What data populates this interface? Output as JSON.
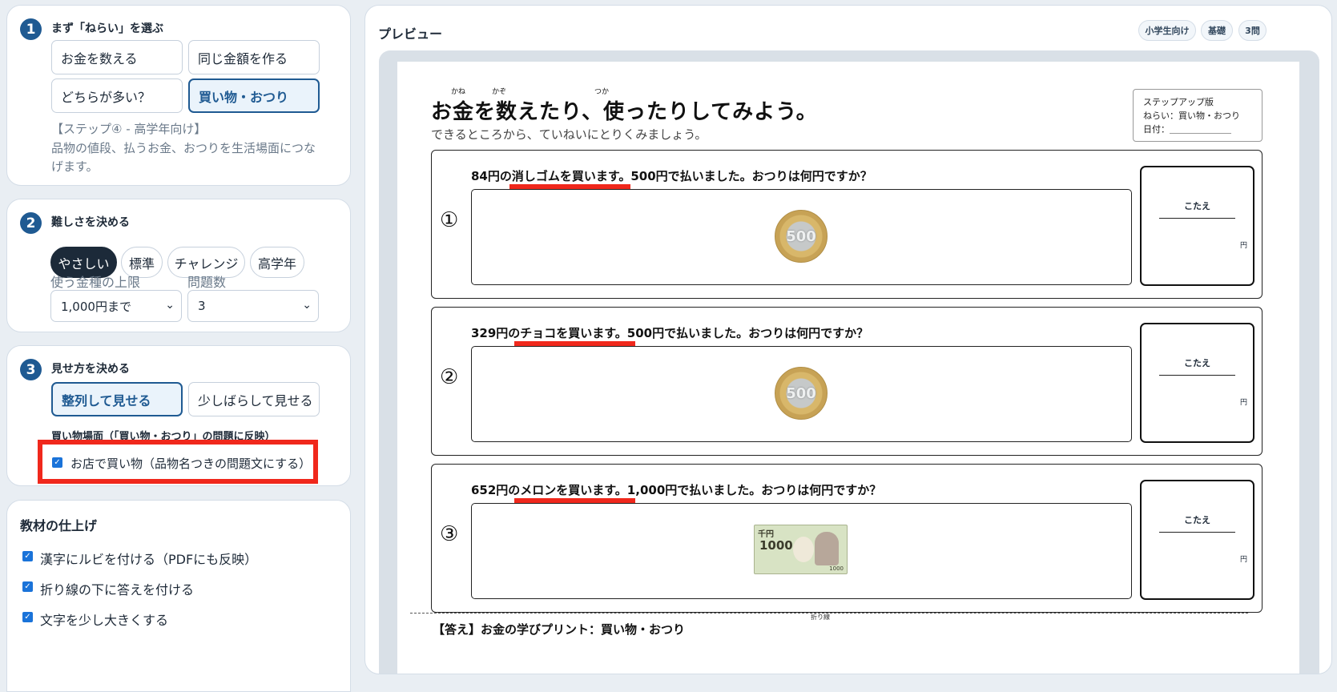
{
  "step1": {
    "num": "1",
    "title": "まず「ねらい」を選ぶ",
    "options": [
      "お金を数える",
      "同じ金額を作る",
      "どちらが多い？",
      "買い物・おつり"
    ],
    "selected": "買い物・おつり",
    "note_tag": "【ステップ④ - 高学年向け】",
    "note_text_1": "品物の値段、払うお金、おつりを生活場面につな",
    "note_text_2": "げます。"
  },
  "step2": {
    "num": "2",
    "title": "難しさを決める",
    "levels": [
      "やさしい",
      "標準",
      "チャレンジ",
      "高学年"
    ],
    "selected_level": "やさしい",
    "max_label": "使う金種の上限",
    "max_value": "1,000円まで",
    "count_label": "問題数",
    "count_value": "3"
  },
  "step3": {
    "num": "3",
    "title": "見せ方を決める",
    "layouts": [
      "整列して見せる",
      "少しばらして見せる"
    ],
    "selected_layout": "整列して見せる",
    "shop_label": "買い物場面（「買い物・おつり」の問題に反映）",
    "shop_checkbox": "お店で買い物（品物名つきの問題文にする）",
    "highlight_color": "#f0281c"
  },
  "finish": {
    "title": "教材の仕上げ",
    "options": [
      "漢字にルビを付ける（PDFにも反映）",
      "折り線の下に答えを付ける",
      "文字を少し大きくする"
    ]
  },
  "preview": {
    "title": "プレビュー",
    "tags": [
      "小学生向け",
      "基礎",
      "3問"
    ],
    "worksheet": {
      "title": "お金を数えたり、使ったりしてみよう。",
      "ruby_kane": "かね",
      "ruby_kazo": "かぞ",
      "ruby_tsuka": "つか",
      "subtitle": "できるところから、ていねいにとりくみましょう。",
      "info": [
        "ステップアップ版",
        "ねらい：買い物・おつり",
        "日付：＿＿＿＿＿＿＿"
      ],
      "answer_label": "こたえ",
      "answer_unit": "円",
      "questions": [
        {
          "num": "①",
          "text": "84円の消しゴムを買います。500円で払いました。おつりは何円ですか？",
          "money": "500"
        },
        {
          "num": "②",
          "text": "329円のチョコを買います。500円で払いました。おつりは何円ですか？",
          "money": "500"
        },
        {
          "num": "③",
          "text": "652円のメロンを買います。1,000円で払いました。おつりは何円ですか？",
          "money_label": "千円",
          "money": "1000"
        }
      ],
      "fold_label": "折り線",
      "answers_title": "【答え】お金の学びプリント：買い物・おつり"
    }
  }
}
